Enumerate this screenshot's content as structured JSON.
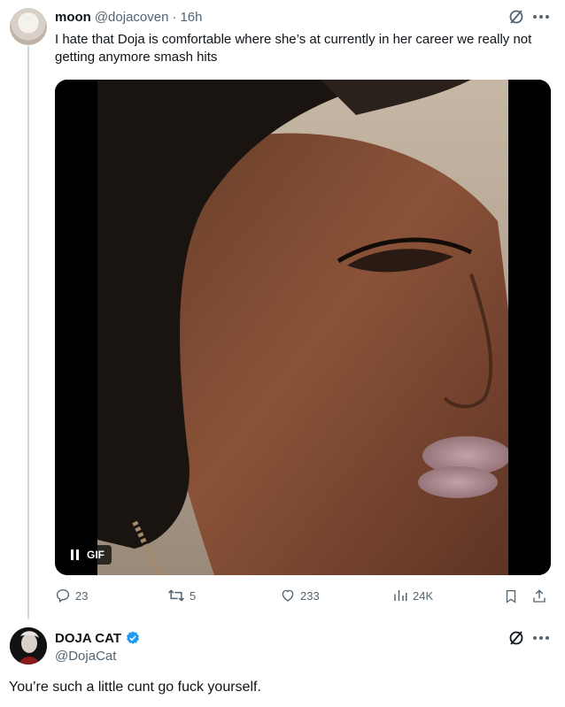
{
  "post": {
    "author_name": "moon",
    "handle": "@dojacoven",
    "separator": "·",
    "time": "16h",
    "text": "I hate that Doja is comfortable where she’s at currently in her career we really not getting anymore smash hits",
    "media": {
      "type": "gif",
      "badge_label": "GIF",
      "pause_icon": "pause-icon"
    },
    "actions": {
      "replies": "23",
      "reposts": "5",
      "likes": "233",
      "views": "24K"
    }
  },
  "reply": {
    "author_name": "DOJA CAT",
    "verified": true,
    "handle": "@DojaCat",
    "text": "You’re such a little cunt go fuck yourself."
  },
  "colors": {
    "text_primary": "#0f1419",
    "text_secondary": "#536471",
    "verified_blue": "#1d9bf0",
    "thread_line": "#cfd9de"
  }
}
